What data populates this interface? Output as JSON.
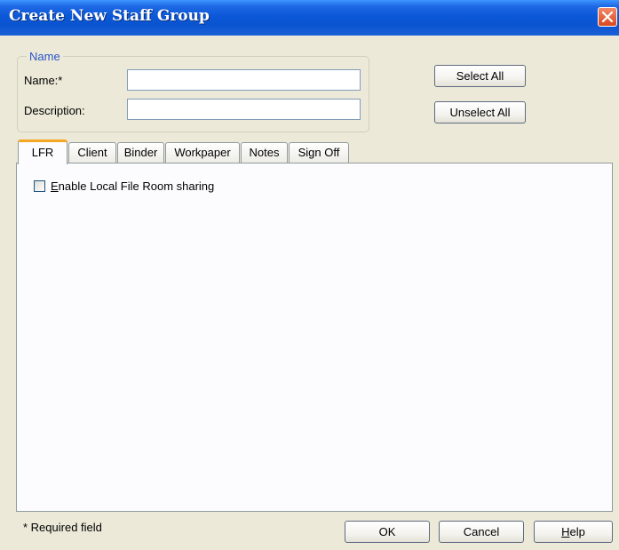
{
  "window": {
    "title": "Create New Staff Group"
  },
  "name_group": {
    "legend": "Name",
    "name_label": "Name:*",
    "name_value": "",
    "description_label": "Description:",
    "description_value": ""
  },
  "buttons": {
    "select_all": "Select All",
    "unselect_all": "Unselect All",
    "ok": "OK",
    "cancel": "Cancel",
    "help_first": "H",
    "help_rest": "elp"
  },
  "tabs": [
    {
      "label": "LFR",
      "active": true
    },
    {
      "label": "Client"
    },
    {
      "label": "Binder"
    },
    {
      "label": "Workpaper"
    },
    {
      "label": "Notes"
    },
    {
      "label": "Sign Off"
    }
  ],
  "lfr_panel": {
    "checkbox_first": "E",
    "checkbox_rest": "nable Local File Room sharing",
    "checked": false
  },
  "footer": {
    "required_note": "* Required field"
  },
  "icons": {
    "close": "close-icon"
  }
}
